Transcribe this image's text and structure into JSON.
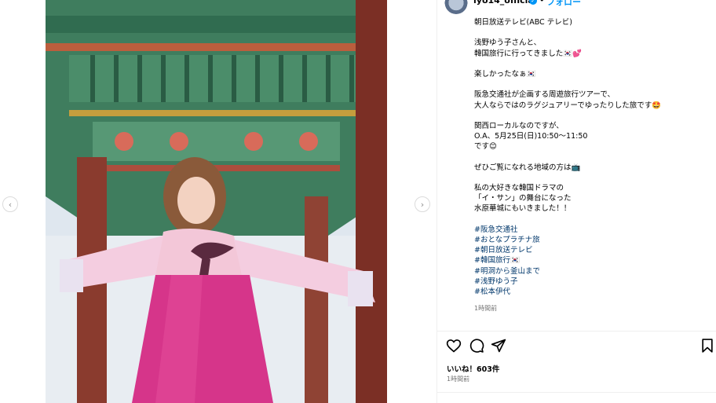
{
  "post": {
    "username": "iyo14_official",
    "follow_label": "フォロー",
    "verified_mark": "✓",
    "more_label": "•••",
    "caption_lines": [
      "朝日放送テレビ(ABC テレビ)",
      "",
      "浅野ゆう子さんと、",
      "韓国旅行に行ってきました🇰🇷💕",
      "",
      "楽しかったなぁ🇰🇷",
      "",
      "阪急交通社が企画する周遊旅行ツアーで、",
      "大人ならではのラグジュアリーでゆったりした旅です🤩",
      "",
      "関西ローカルなのですが、",
      "O.A、5月25日(日)10:50〜11:50",
      "です😊",
      "",
      "ぜひご覧になれる地域の方は📺",
      "",
      "私の大好きな韓国ドラマの",
      "「イ・サン」の舞台になった",
      "水原華城にもいきました！！",
      ""
    ],
    "hashtags": [
      "#阪急交通社",
      "#おとなプラチナ旅",
      "#朝日放送テレビ",
      "#韓国旅行🇰🇷",
      "#明洞から釜山まで",
      "#浅野ゆう子",
      "#松本伊代"
    ],
    "caption_time": "1時間前",
    "likes_text": "いいね！603件",
    "time_text": "1時間前"
  },
  "media": {
    "prev_arrow": "‹",
    "next_arrow": "›"
  },
  "actions": {
    "icons": [
      "heart-icon",
      "comment-icon",
      "share-icon",
      "bookmark-icon"
    ]
  },
  "colors": {
    "link": "#00376b",
    "follow": "#0095f6",
    "muted": "#737373"
  }
}
